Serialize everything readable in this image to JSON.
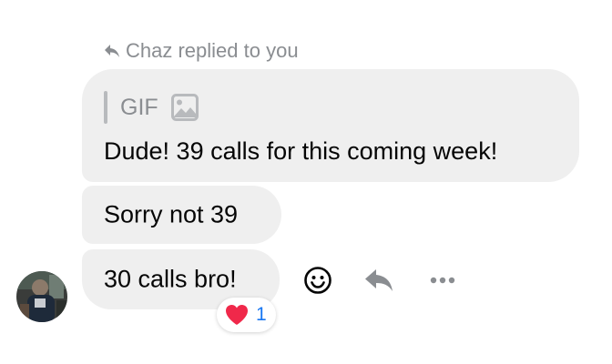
{
  "reply_header": {
    "text": "Chaz replied to you",
    "icon": "reply-arrow-icon"
  },
  "messages": [
    {
      "quoted": {
        "label": "GIF",
        "icon": "image-icon"
      },
      "text": "Dude! 39 calls for this coming week!"
    },
    {
      "text": "Sorry not 39"
    },
    {
      "text": "30 calls bro!"
    }
  ],
  "reaction": {
    "emoji": "heart-icon",
    "count": "1",
    "colors": {
      "heart": "#f0284a",
      "count": "#1877f2"
    }
  },
  "actions": {
    "react_icon": "emoji-smile-icon",
    "reply_icon": "reply-icon",
    "more_icon": "more-horizontal-icon"
  },
  "colors": {
    "bubble": "#efefef",
    "secondary_text": "#8a8d91",
    "text": "#050505"
  }
}
